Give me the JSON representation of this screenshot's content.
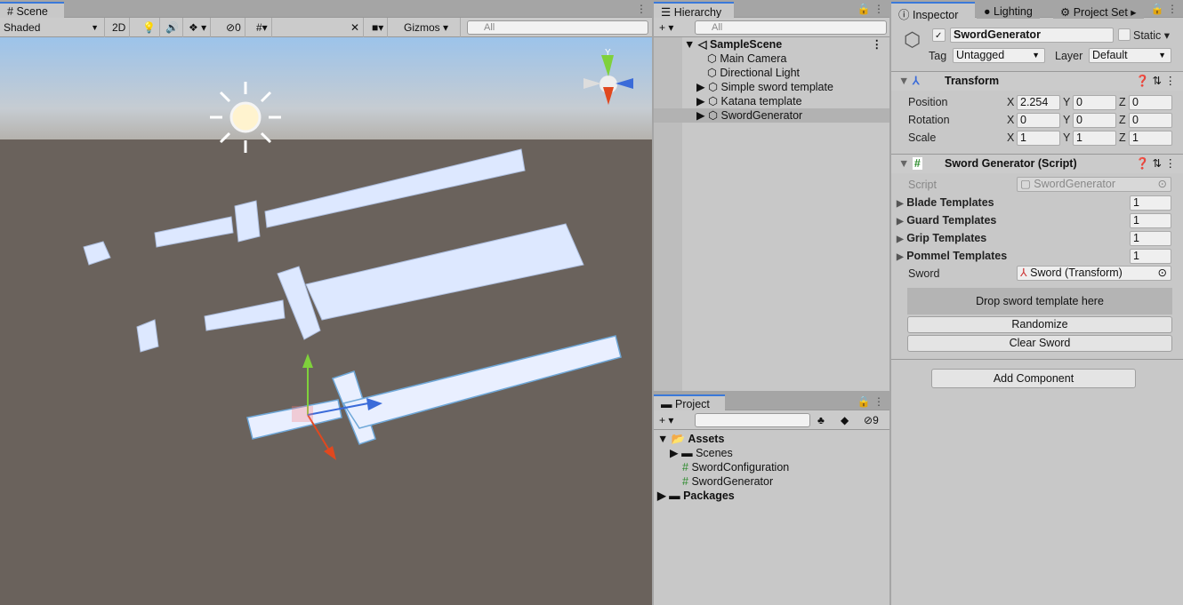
{
  "scene": {
    "tab": "Scene",
    "shading": "Shaded",
    "mode_2d": "2D",
    "hidden_count": "0",
    "gizmos": "Gizmos",
    "search_placeholder": "All"
  },
  "hierarchy": {
    "tab": "Hierarchy",
    "search_placeholder": "All",
    "scene_name": "SampleScene",
    "items": [
      {
        "label": "Main Camera"
      },
      {
        "label": "Directional Light"
      },
      {
        "label": "Simple sword template"
      },
      {
        "label": "Katana template"
      },
      {
        "label": "SwordGenerator"
      }
    ]
  },
  "project": {
    "tab": "Project",
    "hidden_count": "9",
    "assets": "Assets",
    "items": [
      {
        "label": "Scenes"
      },
      {
        "label": "SwordConfiguration"
      },
      {
        "label": "SwordGenerator"
      }
    ],
    "packages": "Packages"
  },
  "inspector": {
    "tabs": [
      {
        "label": "Inspector"
      },
      {
        "label": "Lighting"
      },
      {
        "label": "Project Set"
      }
    ],
    "object_name": "SwordGenerator",
    "static_label": "Static",
    "tag_label": "Tag",
    "tag": "Untagged",
    "layer_label": "Layer",
    "layer": "Default",
    "transform": {
      "title": "Transform",
      "rows": [
        {
          "label": "Position",
          "x": "2.254",
          "y": "0",
          "z": "0"
        },
        {
          "label": "Rotation",
          "x": "0",
          "y": "0",
          "z": "0"
        },
        {
          "label": "Scale",
          "x": "1",
          "y": "1",
          "z": "1"
        }
      ]
    },
    "script_component": {
      "title": "Sword Generator (Script)",
      "script_label": "Script",
      "script_value": "SwordGenerator",
      "lists": [
        {
          "label": "Blade Templates",
          "count": "1"
        },
        {
          "label": "Guard Templates",
          "count": "1"
        },
        {
          "label": "Grip Templates",
          "count": "1"
        },
        {
          "label": "Pommel Templates",
          "count": "1"
        }
      ],
      "sword_label": "Sword",
      "sword_value": "Sword (Transform)",
      "drop_zone": "Drop sword template here",
      "randomize": "Randomize",
      "clear": "Clear Sword"
    },
    "add_component": "Add Component"
  },
  "axis_labels": {
    "x": "X",
    "y": "Y",
    "z": "Z"
  }
}
